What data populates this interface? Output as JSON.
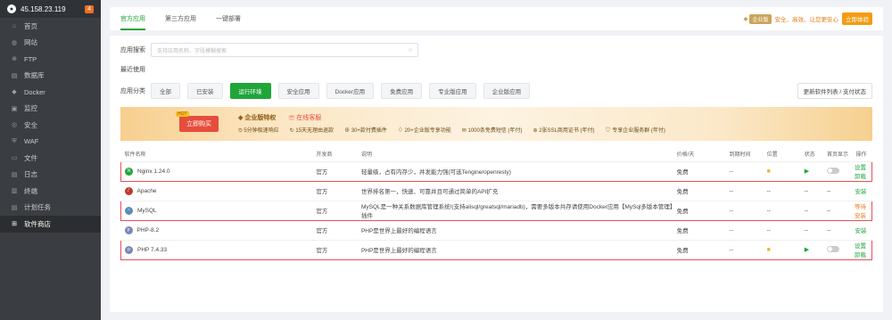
{
  "server": {
    "ip": "45.158.23.119",
    "badge": "4"
  },
  "sidebar": {
    "items": [
      {
        "label": "首页",
        "icon": "home-icon",
        "glyph": "⌂"
      },
      {
        "label": "网站",
        "icon": "globe-icon",
        "glyph": "◍"
      },
      {
        "label": "FTP",
        "icon": "ftp-icon",
        "glyph": "⊕"
      },
      {
        "label": "数据库",
        "icon": "database-icon",
        "glyph": "▤"
      },
      {
        "label": "Docker",
        "icon": "docker-icon",
        "glyph": "◆"
      },
      {
        "label": "监控",
        "icon": "monitor-icon",
        "glyph": "▣"
      },
      {
        "label": "安全",
        "icon": "shield-icon",
        "glyph": "◎"
      },
      {
        "label": "WAF",
        "icon": "waf-icon",
        "glyph": "⛨"
      },
      {
        "label": "文件",
        "icon": "folder-icon",
        "glyph": "▭"
      },
      {
        "label": "日志",
        "icon": "log-icon",
        "glyph": "▤"
      },
      {
        "label": "终端",
        "icon": "terminal-icon",
        "glyph": "▥"
      },
      {
        "label": "计划任务",
        "icon": "schedule-icon",
        "glyph": "▤"
      },
      {
        "label": "软件商店",
        "icon": "store-icon",
        "glyph": "⊞"
      }
    ]
  },
  "tabs": [
    "官方应用",
    "第三方应用",
    "一键部署"
  ],
  "enterprise": {
    "tag": "企业版",
    "slogan": "安全、高效、让您更安心",
    "button": "立即体验"
  },
  "search": {
    "label": "应用搜索",
    "placeholder": "支持应用名称、字段模糊搜索"
  },
  "recent": {
    "label": "最近使用"
  },
  "categories": {
    "label": "应用分类",
    "items": [
      "全部",
      "已安装",
      "运行环境",
      "安全应用",
      "Docker应用",
      "免费应用",
      "专业版应用",
      "企业版应用"
    ],
    "active_index": 2,
    "update_btn": "更新软件列表 / 支付状态"
  },
  "banner": {
    "buy": "立即购买",
    "hot": "HOT",
    "title": "企业版特权",
    "service": "在线客服",
    "perks": [
      "5分钟极速响应",
      "15天无理由退款",
      "30+款付费插件",
      "20+企业版专享功能",
      "1000条免费短信 (年付)",
      "2张SSL商用证书 (年付)",
      "专享企业服务群 (年付)"
    ]
  },
  "table": {
    "headers": [
      "软件名称",
      "开发商",
      "说明",
      "价格/天",
      "到期时间",
      "位置",
      "状态",
      "首页显示",
      "操作"
    ],
    "rows": [
      {
        "name": "Nginx 1.24.0",
        "dev": "官方",
        "desc": "轻量级，占有内存少，并发能力强(可选Tengine/openresty)",
        "price": "免费",
        "expire": "--",
        "installed": true,
        "ops": [
          "设置",
          "卸载"
        ],
        "highlight": true,
        "icon_color": "#20a53a",
        "icon_glyph": "N"
      },
      {
        "name": "Apache",
        "dev": "官方",
        "desc": "世界排名第一，快速、可靠并且可通过简单的API扩充",
        "price": "免费",
        "expire": "--",
        "installed": false,
        "ops": [
          "安装"
        ],
        "highlight": false,
        "icon_color": "#c0392b",
        "icon_glyph": "/"
      },
      {
        "name": "MySQL",
        "dev": "官方",
        "desc": "MySQL是一种关系数据库管理系统!(支持alisql/greatsql/mariadb)，需要多版本共存请使用Docker应用【MySql多版本管理】插件",
        "price": "免费",
        "expire": "--",
        "installed": false,
        "ops": [
          "等待安装"
        ],
        "highlight": true,
        "warn": true,
        "icon_color": "#5b8db8",
        "icon_glyph": "~"
      },
      {
        "name": "PHP-8.2",
        "dev": "官方",
        "desc": "PHP是世界上最好的编程语言",
        "price": "免费",
        "expire": "--",
        "installed": false,
        "ops": [
          "安装"
        ],
        "highlight": false,
        "icon_color": "#7a86b8",
        "icon_glyph": "p"
      },
      {
        "name": "PHP 7.4.33",
        "dev": "官方",
        "desc": "PHP是世界上最好的编程语言",
        "price": "免费",
        "expire": "--",
        "installed": true,
        "ops": [
          "设置",
          "卸载"
        ],
        "highlight": true,
        "icon_color": "#7a86b8",
        "icon_glyph": "p"
      }
    ],
    "dash": "--"
  }
}
